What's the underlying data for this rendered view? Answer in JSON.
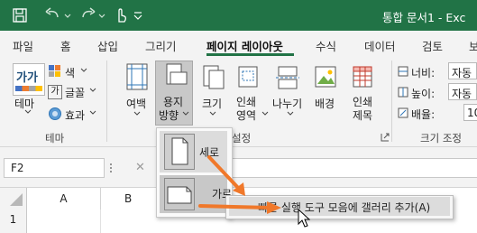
{
  "titlebar": {
    "title": "통합 문서1 - Exc",
    "bg": "#217346"
  },
  "tabs": [
    {
      "label": "파일"
    },
    {
      "label": "홈"
    },
    {
      "label": "삽입"
    },
    {
      "label": "그리기"
    },
    {
      "label": "페이지 레이아웃",
      "active": true
    },
    {
      "label": "수식"
    },
    {
      "label": "데이터"
    },
    {
      "label": "검토"
    },
    {
      "label": "보"
    }
  ],
  "ribbon": {
    "theme": {
      "theme_label": "테마",
      "colors_label": "색",
      "fonts_label": "글꼴",
      "effects_label": "효과",
      "group_label": "테마",
      "thumb_text": "가가"
    },
    "page_setup": {
      "margins_label": "여백",
      "orientation_label_1": "용지",
      "orientation_label_2": "방향",
      "size_label": "크기",
      "print_area_label_1": "인쇄",
      "print_area_label_2": "영역",
      "breaks_label": "나누기",
      "background_label": "배경",
      "print_titles_label_1": "인쇄",
      "print_titles_label_2": "제목",
      "group_label": "설정"
    },
    "scale": {
      "width_label": "너비:",
      "width_value": "자동",
      "height_label": "높이:",
      "height_value": "자동",
      "scale_label": "배율:",
      "scale_value": "10",
      "group_label": "크기 조정"
    }
  },
  "formula_bar": {
    "name_box": "F2",
    "cancel_icon": "✕",
    "formula": ""
  },
  "grid": {
    "columns": [
      "A",
      "B"
    ],
    "rows": [
      "1"
    ]
  },
  "orientation_menu": {
    "items": [
      {
        "label": "세로"
      },
      {
        "label": "가로"
      }
    ]
  },
  "context_menu": {
    "item_label": "빠른 실행 도구 모음에 갤러리 추가(A)"
  },
  "colors": {
    "accent": "#217346",
    "annotation_arrow": "#f0782a"
  }
}
